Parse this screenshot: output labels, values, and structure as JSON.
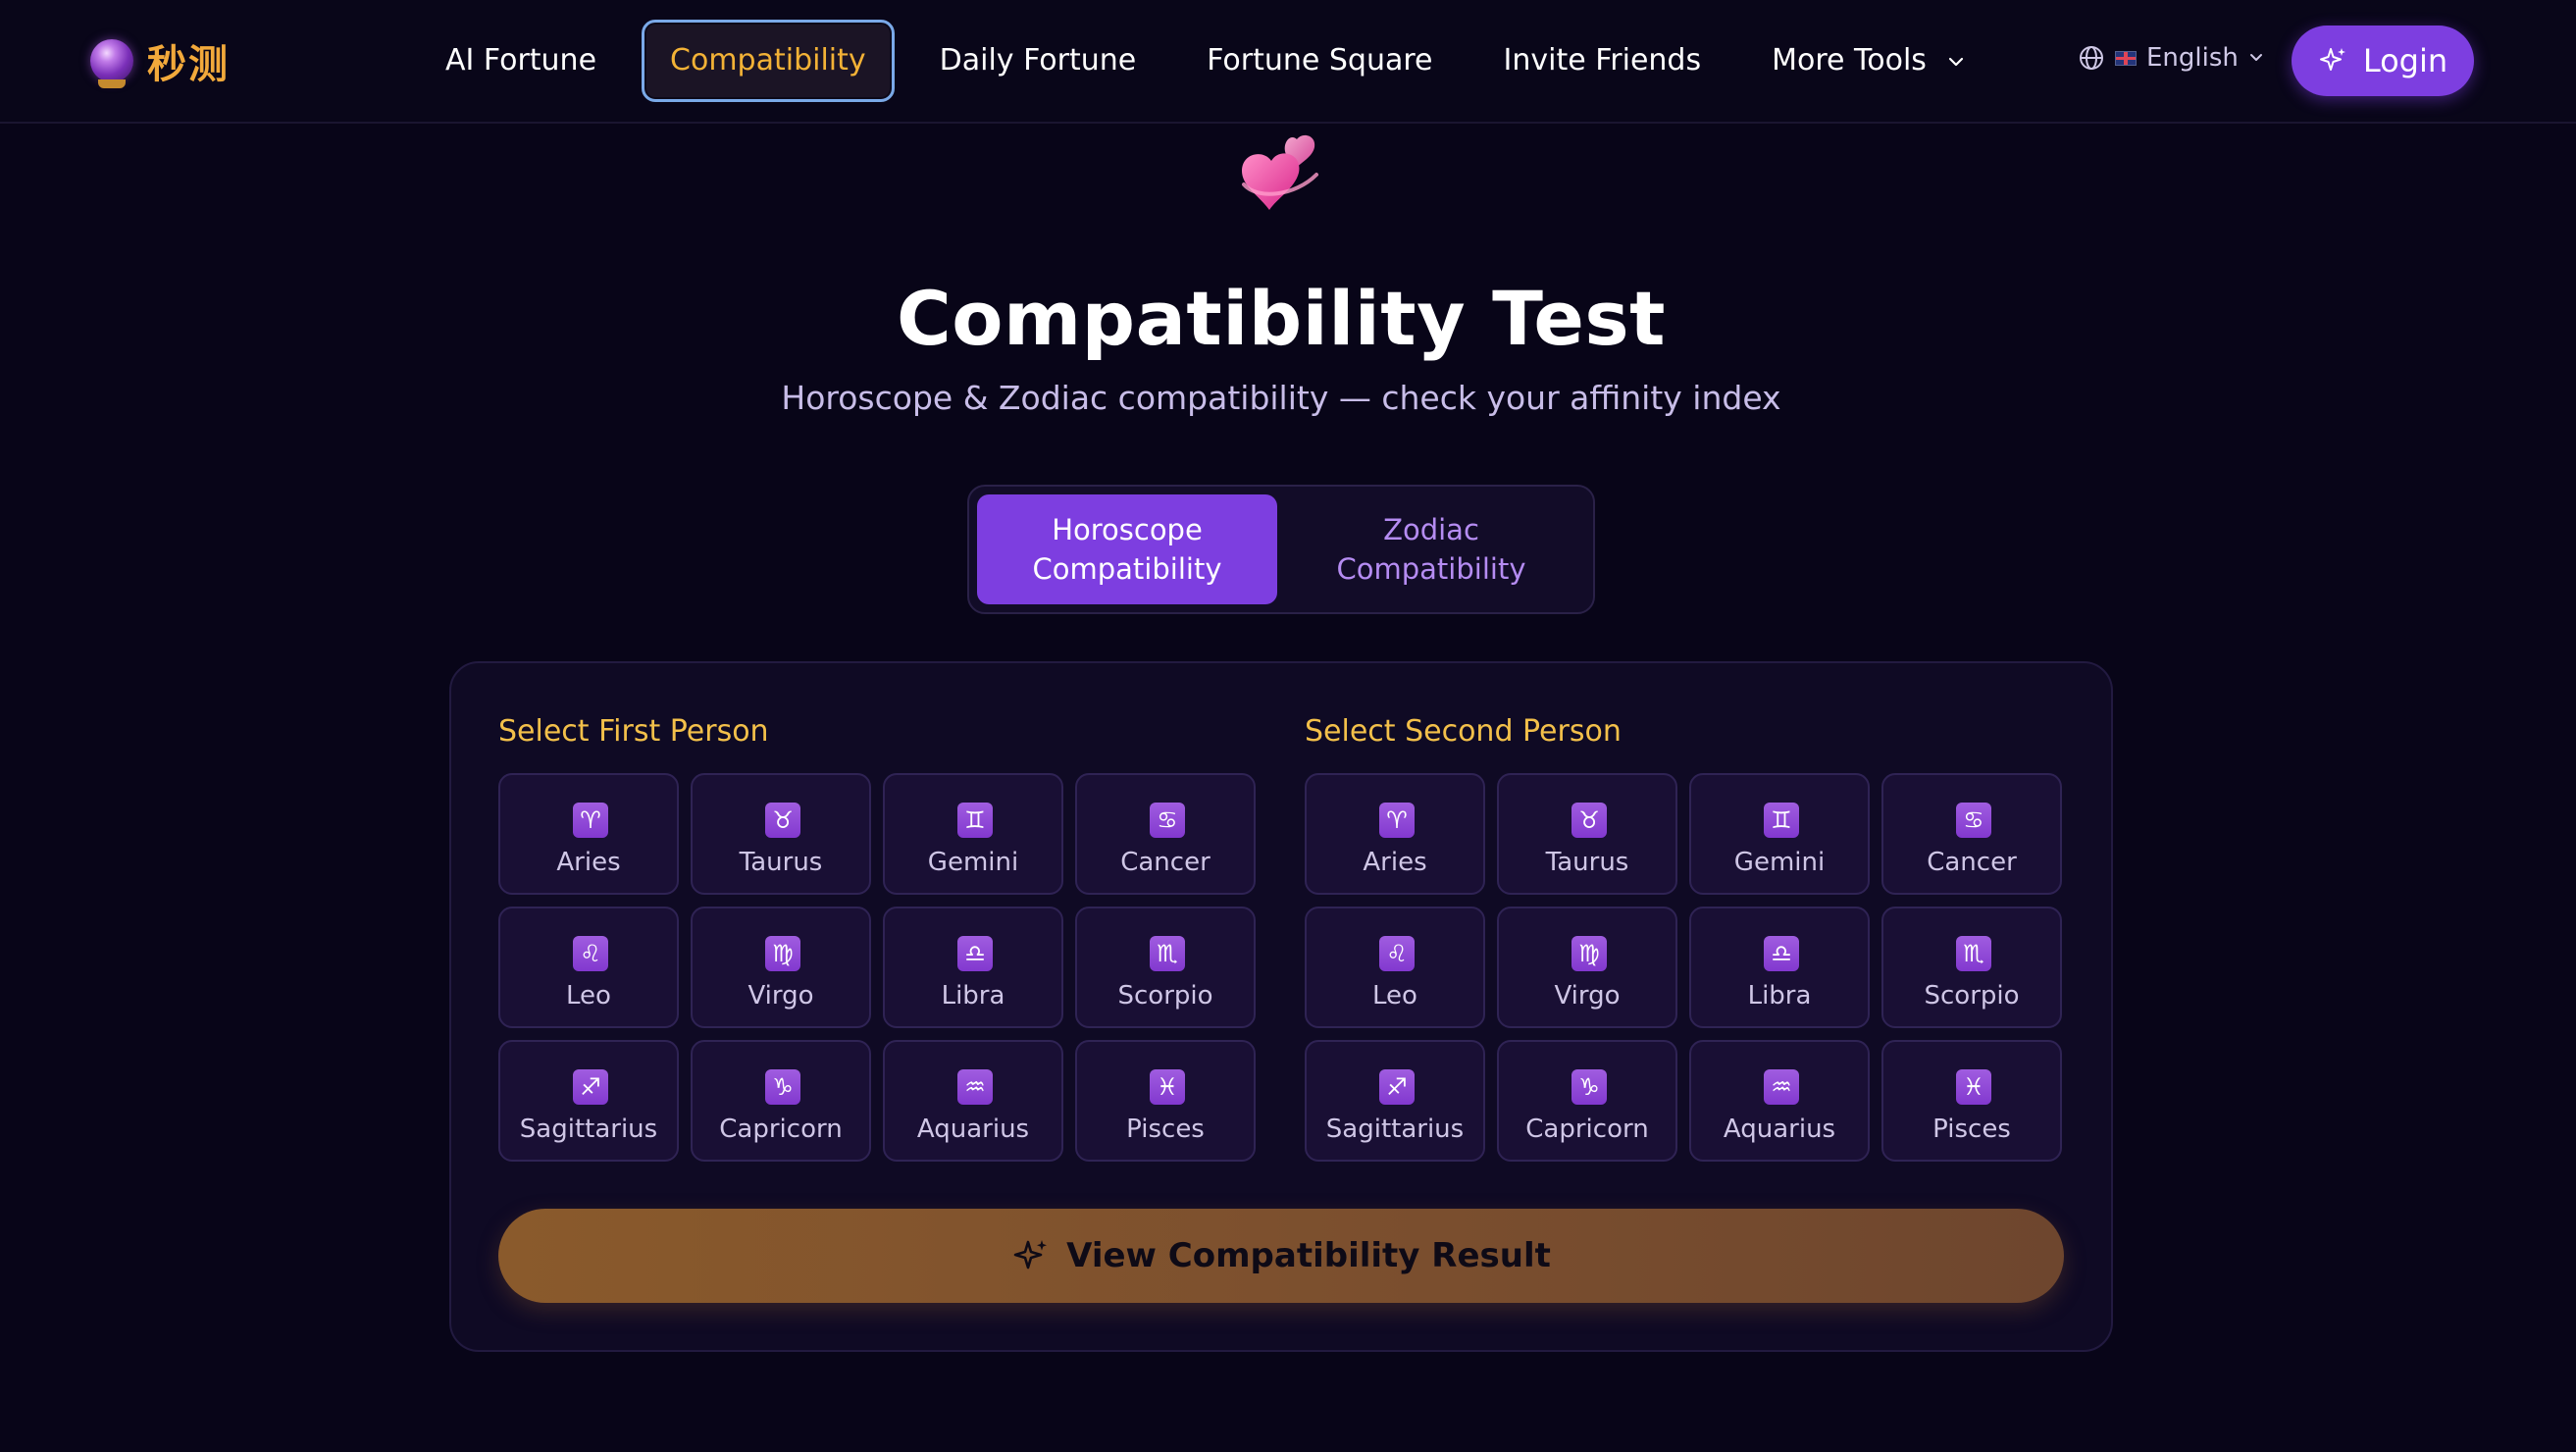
{
  "brand": {
    "name": "秒测",
    "logo_icon": "crystal-ball-icon"
  },
  "nav": {
    "items": [
      {
        "label": "AI Fortune"
      },
      {
        "label": "Compatibility",
        "active": true
      },
      {
        "label": "Daily Fortune"
      },
      {
        "label": "Fortune Square"
      },
      {
        "label": "Invite Friends"
      },
      {
        "label": "More Tools",
        "has_dropdown": true
      }
    ],
    "language": {
      "label": "English",
      "icon": "globe-icon",
      "flag_icon": "uk-flag-icon"
    },
    "login_label": "Login"
  },
  "hero": {
    "icon": "two-hearts-emoji",
    "title": "Compatibility Test",
    "subtitle": "Horoscope & Zodiac compatibility — check your affinity index"
  },
  "tabs": [
    {
      "line1": "Horoscope",
      "line2": "Compatibility",
      "active": true
    },
    {
      "line1": "Zodiac",
      "line2": "Compatibility",
      "active": false
    }
  ],
  "selector": {
    "first_title": "Select First Person",
    "second_title": "Select Second Person",
    "signs": [
      {
        "name": "Aries",
        "symbol": "♈",
        "icon": "aries-icon"
      },
      {
        "name": "Taurus",
        "symbol": "♉",
        "icon": "taurus-icon"
      },
      {
        "name": "Gemini",
        "symbol": "♊",
        "icon": "gemini-icon"
      },
      {
        "name": "Cancer",
        "symbol": "♋",
        "icon": "cancer-icon"
      },
      {
        "name": "Leo",
        "symbol": "♌",
        "icon": "leo-icon"
      },
      {
        "name": "Virgo",
        "symbol": "♍",
        "icon": "virgo-icon"
      },
      {
        "name": "Libra",
        "symbol": "♎",
        "icon": "libra-icon"
      },
      {
        "name": "Scorpio",
        "symbol": "♏",
        "icon": "scorpio-icon"
      },
      {
        "name": "Sagittarius",
        "symbol": "♐",
        "icon": "sagittarius-icon"
      },
      {
        "name": "Capricorn",
        "symbol": "♑",
        "icon": "capricorn-icon"
      },
      {
        "name": "Aquarius",
        "symbol": "♒",
        "icon": "aquarius-icon"
      },
      {
        "name": "Pisces",
        "symbol": "♓",
        "icon": "pisces-icon"
      }
    ],
    "cta_label": "View Compatibility Result",
    "cta_icon": "sparkle-icon"
  },
  "colors": {
    "background": "#080518",
    "accent_purple": "#7d3ee0",
    "accent_gold": "#f3b236",
    "section_title": "#f3c04a",
    "cta_brown": "#8a5a2c"
  }
}
